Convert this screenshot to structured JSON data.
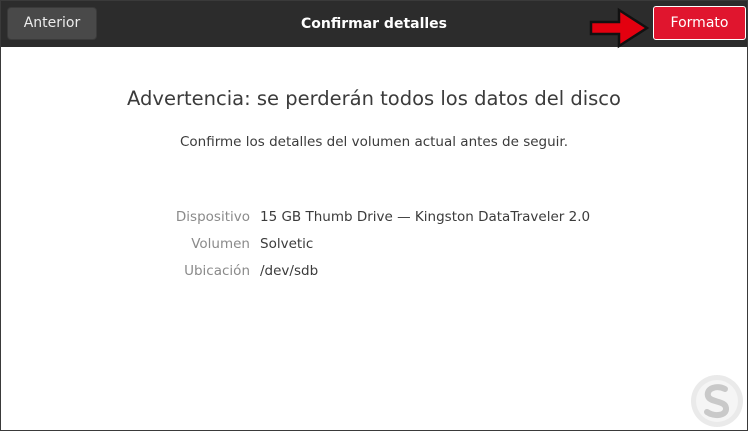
{
  "header": {
    "back_label": "Anterior",
    "title": "Confirmar detalles",
    "format_label": "Formato",
    "format_color": "#e0152e"
  },
  "main": {
    "warning": "Advertencia: se perderán todos los datos del disco",
    "subtitle": "Confirme los detalles del volumen actual antes de seguir.",
    "details": [
      {
        "label": "Dispositivo",
        "value": "15 GB Thumb Drive — Kingston DataTraveler 2.0"
      },
      {
        "label": "Volumen",
        "value": "Solvetic"
      },
      {
        "label": "Ubicación",
        "value": "/dev/sdb"
      }
    ]
  },
  "annotation": {
    "arrow_icon": "red-arrow-icon",
    "arrow_color": "#e3000f"
  },
  "watermark": {
    "icon": "solvetic-logo-icon"
  }
}
